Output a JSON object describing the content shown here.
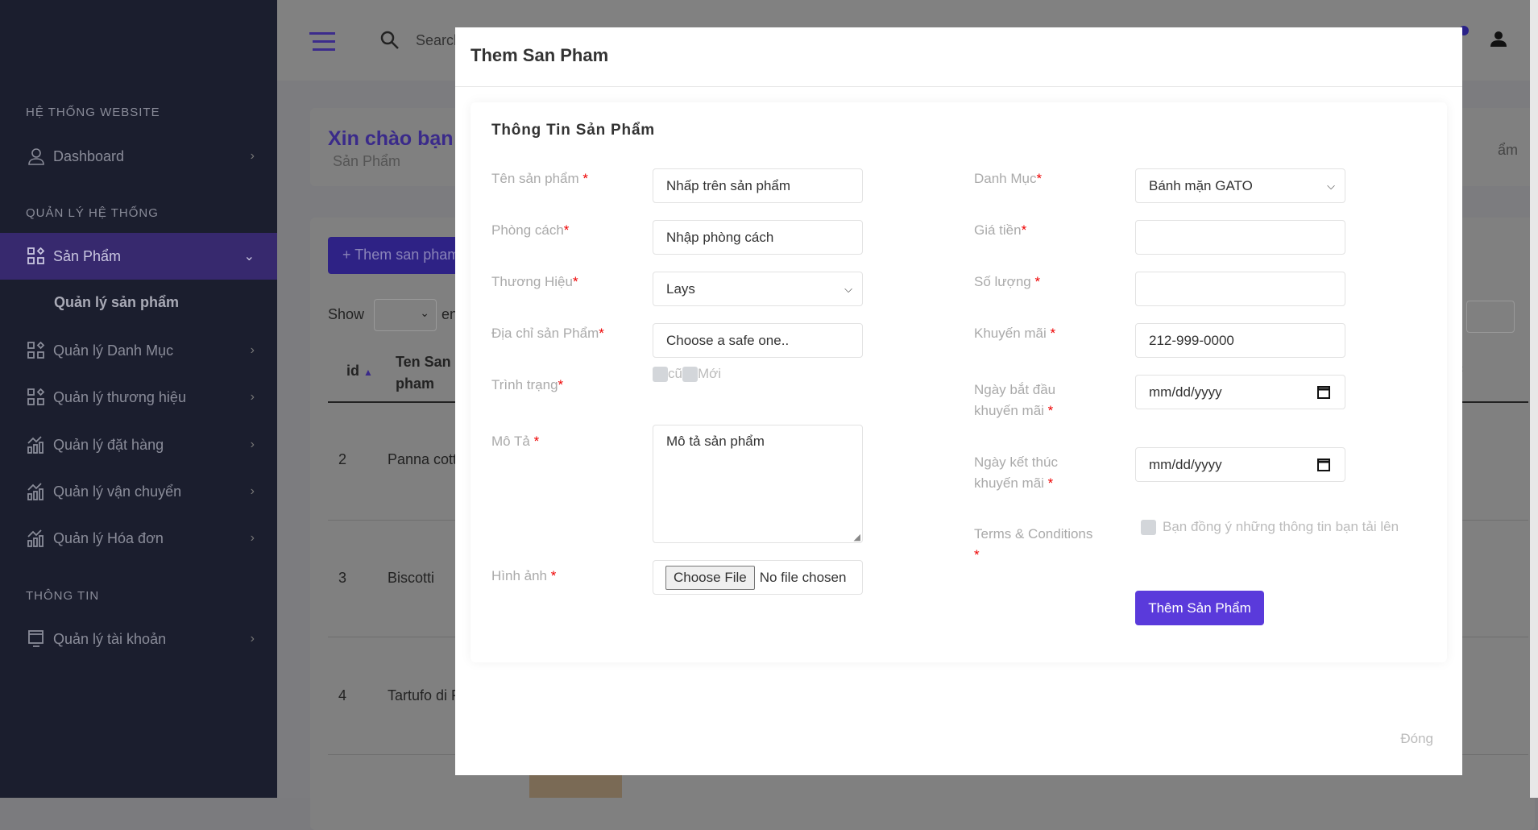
{
  "header": {
    "search_placeholder": "Search"
  },
  "sidebar": {
    "section1": "HỆ THỐNG WEBSITE",
    "dashboard": "Dashboard",
    "section2": "QUẢN LÝ HỆ THỐNG",
    "san_pham": "Sản Phẩm",
    "sub_quan_ly_san_pham": "Quản lý sản phẩm",
    "danh_muc": "Quản lý Danh Mục",
    "thuong_hieu": "Quản lý thương hiệu",
    "dat_hang": "Quản lý đặt hàng",
    "van_chuyen": "Quản lý vận chuyển",
    "hoa_don": "Quản lý Hóa đơn",
    "section3": "THÔNG TIN",
    "tai_khoan": "Quản lý tài khoản"
  },
  "page": {
    "greeting": "Xin chào bạn",
    "subtitle": "Sản Phẩm",
    "breadcrumb_fragment": "ẩm",
    "add_button": "+ Them san pham",
    "show_label": "Show",
    "entries_fragment": "entr",
    "table": {
      "headers": [
        "id",
        "Ten San pham"
      ],
      "rows": [
        [
          "2",
          "Panna cott"
        ],
        [
          "3",
          "Biscotti"
        ],
        [
          "4",
          "Tartufo di F"
        ]
      ]
    }
  },
  "modal": {
    "title": "Them San Pham",
    "form_title": "Thông Tin Sản Phẩm",
    "fields": {
      "ten": {
        "label": "Tên sản phẩm ",
        "value": "Nhấp trên sản phẩm"
      },
      "phong_cach": {
        "label": "Phòng cách",
        "value": "Nhập phòng cách"
      },
      "thuong_hieu": {
        "label": "Thương Hiệu",
        "value": "Lays"
      },
      "dia_chi": {
        "label": "Địa chỉ sản Phẩm",
        "value": "Choose a safe one.."
      },
      "tinh_trang": {
        "label": "Trình trạng",
        "opt1": "cũ",
        "opt2": "Mới"
      },
      "mo_ta": {
        "label": "Mô Tả ",
        "value": "Mô tả sản phẩm"
      },
      "hinh_anh": {
        "label": "Hình ảnh ",
        "button": "Choose File",
        "status": "No file chosen"
      },
      "danh_muc": {
        "label": "Danh Mục",
        "value": "Bánh mặn GATO"
      },
      "gia_tien": {
        "label": "Giá tiền",
        "value": ""
      },
      "so_luong": {
        "label": "Số lượng ",
        "value": ""
      },
      "khuyen_mai": {
        "label": "Khuyến mãi ",
        "value": "212-999-0000"
      },
      "ngay_bat_dau": {
        "label1": "Ngày bắt đầu",
        "label2": "khuyến mãi ",
        "value": "mm/dd/yyyy"
      },
      "ngay_ket_thuc": {
        "label1": "Ngày kết thúc",
        "label2": "khuyến mãi ",
        "value": "mm/dd/yyyy"
      },
      "terms": {
        "label": "Terms & Conditions",
        "text": "Bạn đồng ý những thông tin bạn tải lên"
      }
    },
    "required_mark": "*",
    "submit": "Thêm Sản Phẩm",
    "close": "Đóng"
  },
  "colors": {
    "accent": "#5a3adb",
    "sidebar": "#1b1e2e",
    "required": "#e00000"
  }
}
